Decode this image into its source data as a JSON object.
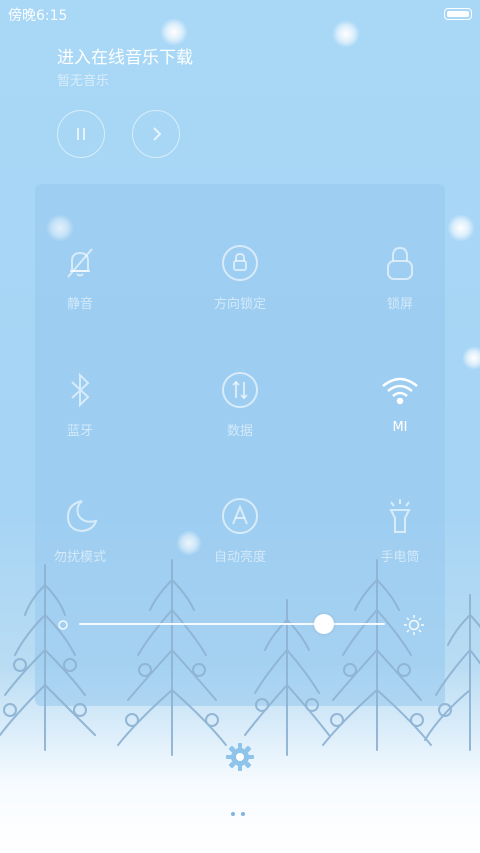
{
  "status_bar": {
    "time": "傍晚6:15"
  },
  "music": {
    "title": "进入在线音乐下载",
    "subtitle": "暂无音乐"
  },
  "toggles": [
    {
      "label": "静音",
      "icon": "mute-bell-icon",
      "state": "off"
    },
    {
      "label": "方向锁定",
      "icon": "rotation-lock-icon",
      "state": "off"
    },
    {
      "label": "锁屏",
      "icon": "lock-icon",
      "state": "off"
    },
    {
      "label": "蓝牙",
      "icon": "bluetooth-icon",
      "state": "off"
    },
    {
      "label": "数据",
      "icon": "mobile-data-icon",
      "state": "off"
    },
    {
      "label": "MI",
      "icon": "wifi-icon",
      "state": "on"
    },
    {
      "label": "勿扰模式",
      "icon": "moon-icon",
      "state": "off"
    },
    {
      "label": "自动亮度",
      "icon": "auto-brightness-icon",
      "state": "off"
    },
    {
      "label": "手电筒",
      "icon": "flashlight-icon",
      "state": "off"
    }
  ],
  "brightness": {
    "level": 0.8
  },
  "colors": {
    "background": "#a9d8f7",
    "panel": "#96c8ee",
    "accent": "#ffffff"
  }
}
